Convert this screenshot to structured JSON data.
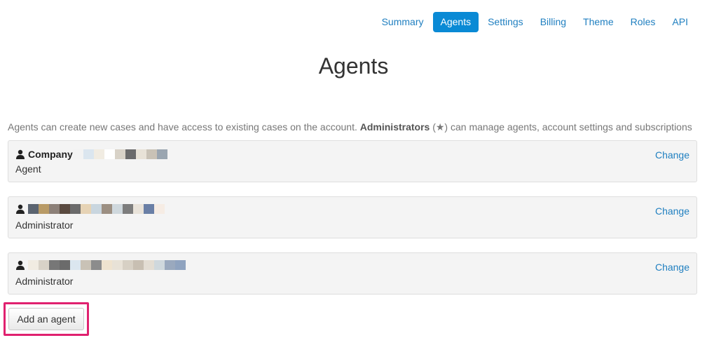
{
  "nav": {
    "items": [
      {
        "label": "Summary",
        "active": false
      },
      {
        "label": "Agents",
        "active": true
      },
      {
        "label": "Settings",
        "active": false
      },
      {
        "label": "Billing",
        "active": false
      },
      {
        "label": "Theme",
        "active": false
      },
      {
        "label": "Roles",
        "active": false
      },
      {
        "label": "API",
        "active": false
      }
    ],
    "accent_color": "#0a8ad5"
  },
  "page": {
    "title": "Agents",
    "intro_text_before": "Agents can create new cases and have access to existing cases on the account. ",
    "intro_bold": "Administrators",
    "intro_text_after": " (★) can manage agents, account settings and subscriptions"
  },
  "agents": [
    {
      "name": "Company",
      "role": "Agent",
      "change_label": "Change",
      "icon": "user-icon"
    },
    {
      "name": "",
      "role": "Administrator",
      "change_label": "Change",
      "icon": "user-icon"
    },
    {
      "name": "",
      "role": "Administrator",
      "change_label": "Change",
      "icon": "user-icon"
    }
  ],
  "actions": {
    "add_agent_label": "Add an agent",
    "highlight_color": "#e0216f"
  }
}
